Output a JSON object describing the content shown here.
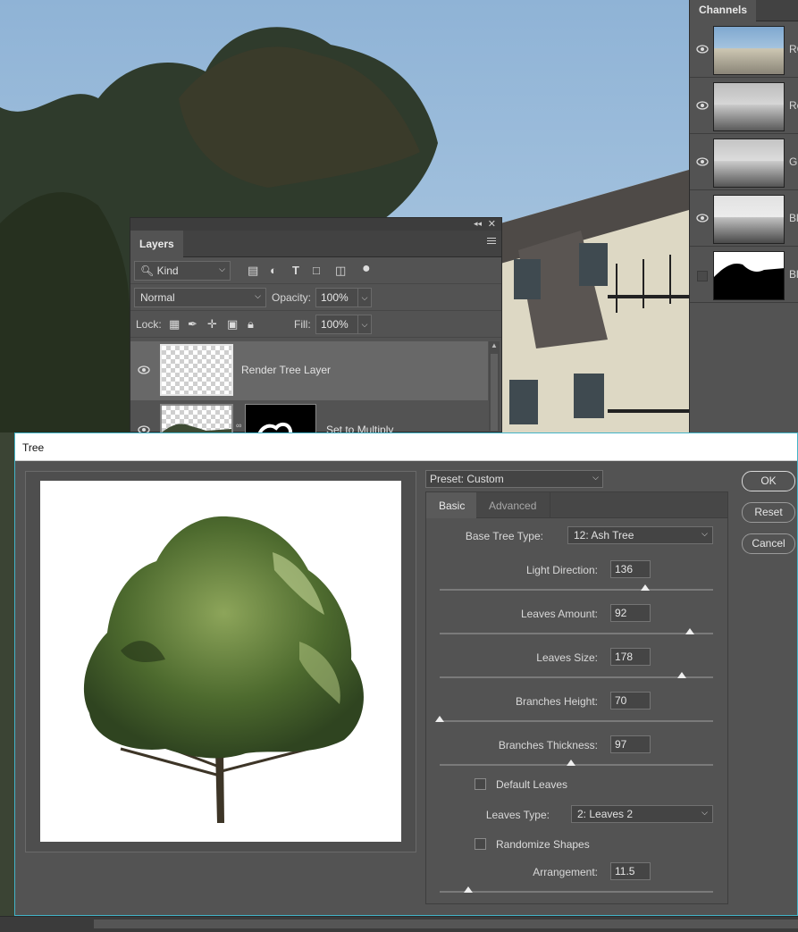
{
  "channels": {
    "tab_label": "Channels",
    "rows": [
      {
        "label": "RG",
        "visible": true
      },
      {
        "label": "Re",
        "visible": true
      },
      {
        "label": "Gr",
        "visible": true
      },
      {
        "label": "Bl",
        "visible": true
      },
      {
        "label": "Bl",
        "visible": false
      }
    ]
  },
  "layers": {
    "tab_label": "Layers",
    "filter": {
      "kind_label": "Kind"
    },
    "blend_mode": "Normal",
    "opacity_label": "Opacity:",
    "opacity_value": "100%",
    "lock_label": "Lock:",
    "fill_label": "Fill:",
    "fill_value": "100%",
    "items": [
      {
        "name": "Render Tree Layer",
        "selected": true
      },
      {
        "name": "Set to Multiply",
        "selected": false
      }
    ]
  },
  "dialog": {
    "title": "Tree",
    "preset_label": "Preset: Custom",
    "tabs": {
      "basic": "Basic",
      "advanced": "Advanced"
    },
    "base_tree_type_label": "Base Tree Type:",
    "base_tree_type_value": "12: Ash Tree",
    "params": [
      {
        "label": "Light Direction:",
        "value": "136",
        "fraction": 0.75
      },
      {
        "label": "Leaves Amount:",
        "value": "92",
        "fraction": 0.915
      },
      {
        "label": "Leaves Size:",
        "value": "178",
        "fraction": 0.885
      },
      {
        "label": "Branches Height:",
        "value": "70",
        "fraction": 0.0
      },
      {
        "label": "Branches Thickness:",
        "value": "97",
        "fraction": 0.48
      }
    ],
    "default_leaves_label": "Default Leaves",
    "default_leaves_checked": false,
    "leaves_type_label": "Leaves Type:",
    "leaves_type_value": "2: Leaves 2",
    "randomize_label": "Randomize Shapes",
    "randomize_checked": false,
    "arrangement_label": "Arrangement:",
    "arrangement_value": "11.5",
    "arrangement_fraction": 0.105,
    "buttons": {
      "ok": "OK",
      "reset": "Reset",
      "cancel": "Cancel"
    }
  },
  "colors": {
    "dialog_border": "#43b4c8",
    "panel_bg": "#535353"
  }
}
